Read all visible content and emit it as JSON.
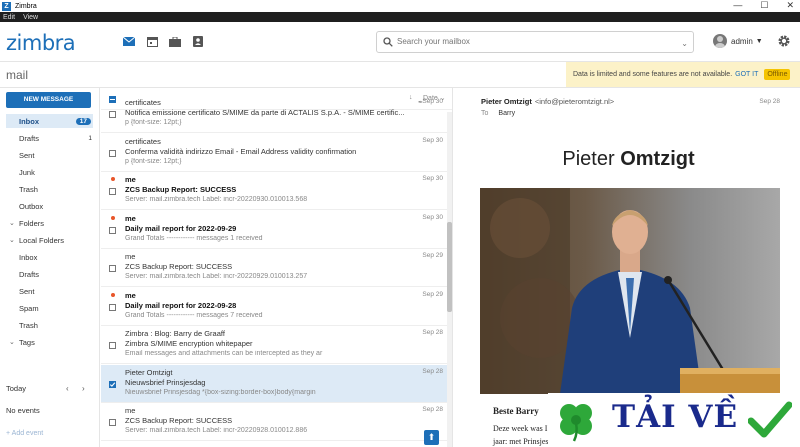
{
  "window": {
    "title": "Zimbra",
    "logo_letter": "Z",
    "controls": [
      "—",
      "☐",
      "✕"
    ]
  },
  "menubar": [
    "Edit",
    "View"
  ],
  "header": {
    "brand": "zimbra",
    "apps": [
      "mail-icon",
      "calendar-icon",
      "briefcase-icon",
      "contacts-icon"
    ],
    "search_placeholder": "Search your mailbox",
    "user": "admin"
  },
  "breadcrumb": "mail",
  "notice": {
    "text": "Data is limited and some features are not available.",
    "action": "GOT IT",
    "badge": "Offline"
  },
  "sidebar": {
    "new_message": "NEW MESSAGE",
    "folders": [
      {
        "label": "Inbox",
        "count": "17",
        "selected": true
      },
      {
        "label": "Drafts",
        "count": "1"
      },
      {
        "label": "Sent",
        "count": ""
      },
      {
        "label": "Junk",
        "count": ""
      },
      {
        "label": "Trash",
        "count": ""
      },
      {
        "label": "Outbox",
        "count": ""
      },
      {
        "label": "Folders",
        "count": "",
        "chevron": true
      },
      {
        "label": "Local Folders",
        "count": "",
        "chevron": true
      },
      {
        "label": "Inbox",
        "count": ""
      },
      {
        "label": "Drafts",
        "count": ""
      },
      {
        "label": "Sent",
        "count": ""
      },
      {
        "label": "Spam",
        "count": ""
      },
      {
        "label": "Trash",
        "count": ""
      },
      {
        "label": "Tags",
        "count": "",
        "chevron": true
      }
    ],
    "today": "Today",
    "no_events": "No events",
    "add_event": "+ Add event"
  },
  "list": {
    "sort_label": "Date",
    "messages": [
      {
        "sender": "certificates",
        "subject": "Notifica emissione certificato S/MIME da parte di ACTALIS S.p.A. - S/MIME certific...",
        "preview": "p {font-size: 12pt;}",
        "date": "Sep 30",
        "unread": false,
        "dot": false
      },
      {
        "sender": "certificates",
        "subject": "Conferma validità indirizzo Email - Email Address validity confirmation",
        "preview": "p {font-size: 12pt;}",
        "date": "Sep 30",
        "unread": false,
        "dot": false
      },
      {
        "sender": "me",
        "subject": "ZCS Backup Report: SUCCESS",
        "preview": "Server: mail.zimbra.tech Label: incr-20220930.010013.568",
        "date": "Sep 30",
        "unread": true,
        "dot": true
      },
      {
        "sender": "me",
        "subject": "Daily mail report for 2022-09-29",
        "preview": "Grand Totals ------------ messages 1 received",
        "date": "Sep 30",
        "unread": true,
        "dot": true
      },
      {
        "sender": "me",
        "subject": "ZCS Backup Report: SUCCESS",
        "preview": "Server: mail.zimbra.tech Label: incr-20220929.010013.257",
        "date": "Sep 29",
        "unread": false,
        "dot": false
      },
      {
        "sender": "me",
        "subject": "Daily mail report for 2022-09-28",
        "preview": "Grand Totals ------------ messages 7 received",
        "date": "Sep 29",
        "unread": true,
        "dot": true
      },
      {
        "sender": "Zimbra : Blog: Barry de Graaff",
        "subject": "Zimbra S/MIME encryption whitepaper",
        "preview": "Email messages and attachments can be intercepted as they ar",
        "date": "Sep 28",
        "unread": false,
        "dot": false
      },
      {
        "sender": "Pieter Omtzigt",
        "subject": "Nieuwsbrief Prinsjesdag",
        "preview": "Nieuwsbrief Prinsjesdag *{box-sizing:border-box}body{margin",
        "date": "Sep 28",
        "unread": false,
        "dot": false,
        "selected": true
      },
      {
        "sender": "me",
        "subject": "ZCS Backup Report: SUCCESS",
        "preview": "Server: mail.zimbra.tech Label: incr-20220928.010012.886",
        "date": "Sep 28",
        "unread": false,
        "dot": false
      }
    ]
  },
  "reading": {
    "from_name": "Pieter Omtzigt",
    "from_email": "<info@pieteromtzigt.nl>",
    "date": "Sep 28",
    "to_label": "To",
    "to": "Barry",
    "title_light": "Pieter",
    "title_bold": "Omtzigt",
    "greeting": "Beste Barry",
    "body_line1": "Deze week was I",
    "body_line2": "jaar: met Prinsjesdag kondigt de regering de plannen aan voor het komende jaar."
  },
  "watermark": {
    "text": "TẢI VỀ"
  },
  "colors": {
    "brand": "#1d6fb8",
    "unread_dot": "#e8562a",
    "notice_bg": "#fcf2c8",
    "selection": "#ddeaf6"
  }
}
